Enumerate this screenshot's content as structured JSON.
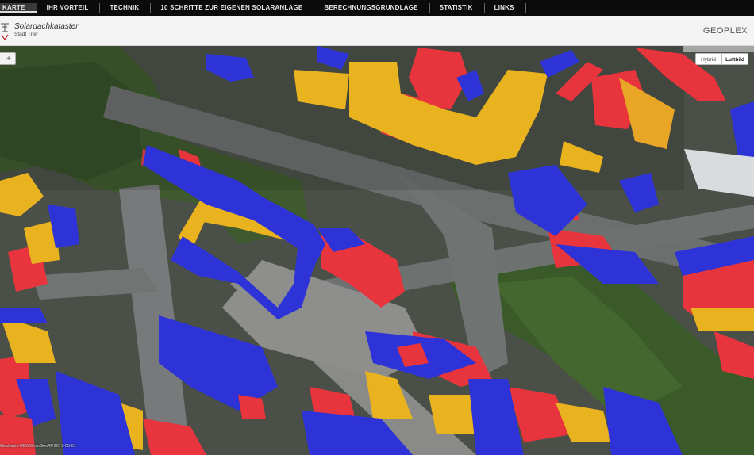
{
  "nav": {
    "items": [
      {
        "label": "KARTE",
        "active": true
      },
      {
        "label": "IHR VORTEIL",
        "active": false
      },
      {
        "label": "TECHNIK",
        "active": false
      },
      {
        "label": "10 SCHRITTE ZUR EIGENEN SOLARANLAGE",
        "active": false
      },
      {
        "label": "BERECHNUNGSGRUNDLAGE",
        "active": false
      },
      {
        "label": "STATISTIK",
        "active": false
      },
      {
        "label": "LINKS",
        "active": false
      }
    ]
  },
  "header": {
    "title": "Solardachkataster",
    "subtitle": "Stadt Trier",
    "brand": "GEOPLEX",
    "brand_sub": "GEOPLEX"
  },
  "map": {
    "zoom_control_glyph": "+",
    "maptypes": [
      {
        "label": "Hybrid",
        "selected": false
      },
      {
        "label": "Luftbild",
        "selected": true
      }
    ],
    "copyright": "Geobasis-DE/LVermGeoRP2017-05-01",
    "legend_colors": {
      "red": "#e8353d",
      "yellow": "#e9b21f",
      "blue": "#2d33d6",
      "orange": "#e9a526"
    }
  }
}
